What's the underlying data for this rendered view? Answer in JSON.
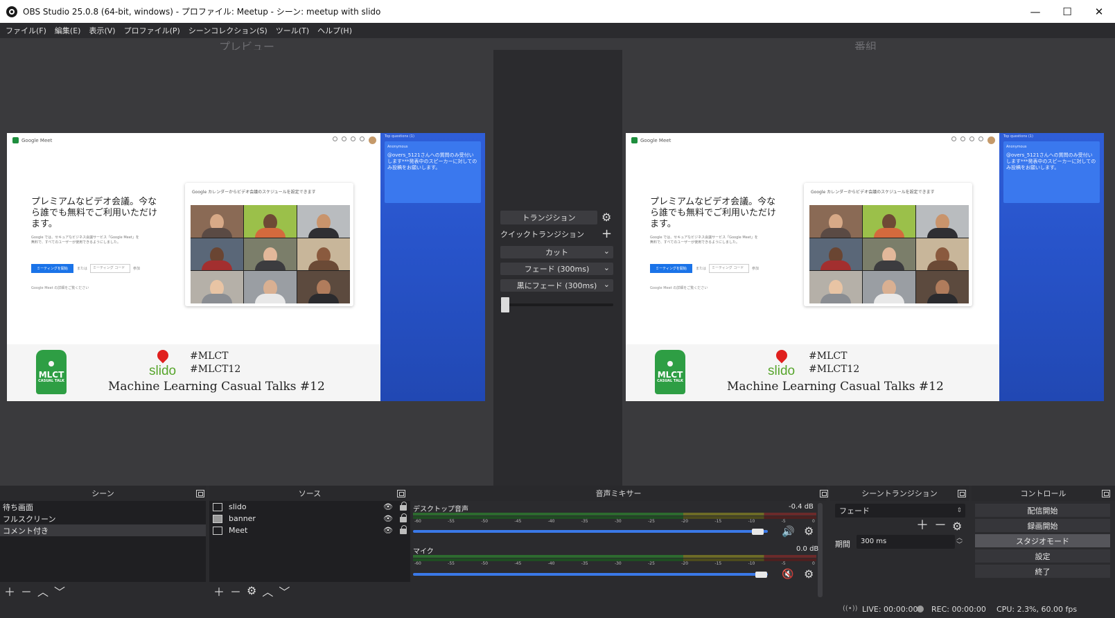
{
  "window": {
    "title": "OBS Studio 25.0.8 (64-bit, windows) - プロファイル: Meetup - シーン: meetup with slido",
    "minimize": "—",
    "maximize": "☐",
    "close": "✕"
  },
  "menu": [
    "ファイル(F)",
    "編集(E)",
    "表示(V)",
    "プロファイル(P)",
    "シーンコレクション(S)",
    "ツール(T)",
    "ヘルプ(H)"
  ],
  "preview": {
    "left_label": "プレビュー",
    "right_label": "番組"
  },
  "canvas": {
    "meet_brand": "Google Meet",
    "headline": "プレミアムなビデオ会議。今なら誰でも無料でご利用いただけます。",
    "subtext": "Google では、セキュアなビジネス会議サービス「Google Meet」を無料で、すべてのユーザーが使用できるようにしました。",
    "start_button": "ミーティングを開始",
    "or_text": "または",
    "code_placeholder": "ミーティング コード",
    "join_text": "参加",
    "learn_more": "Google Meet の詳細をご覧ください",
    "card_caption": "Google カレンダーからビデオ会議のスケジュールを設定できます",
    "tag_line1": "MLCT",
    "tag_line2": "CASUAL TALK",
    "slido": "slido",
    "hashtag1": "#MLCT",
    "hashtag2": "#MLCT12",
    "talk_title": "Machine Learning Casual Talks #12",
    "slido_header": "Top questions (1)",
    "slido_user": "Anonymous",
    "slido_question": "@overs_5121さんへの質問のみ受付いします***発表中のスピーカーに対してのみ投稿をお願いします。"
  },
  "transitions": {
    "transition_label": "トランジション",
    "quick_label": "クイックトランジション",
    "items": [
      "カット",
      "フェード (300ms)",
      "黒にフェード (300ms)"
    ]
  },
  "docks": {
    "scenes": {
      "title": "シーン",
      "items": [
        "待ち画面",
        "フルスクリーン",
        "コメント付き"
      ],
      "selected": "コメント付き"
    },
    "sources": {
      "title": "ソース",
      "items": [
        "slido",
        "banner",
        "Meet"
      ]
    },
    "mixer": {
      "title": "音声ミキサー",
      "channels": [
        {
          "name": "デスクトップ音声",
          "db": "-0.4 dB",
          "volume": 0.97,
          "muted": false
        },
        {
          "name": "マイク",
          "db": "0.0 dB",
          "volume": 0.98,
          "muted": true
        }
      ],
      "ticks": [
        "-60",
        "-55",
        "-50",
        "-45",
        "-40",
        "-35",
        "-30",
        "-25",
        "-20",
        "-15",
        "-10",
        "-5",
        "0"
      ]
    },
    "scene_transitions": {
      "title": "シーントランジション",
      "selected": "フェード",
      "duration_label": "期間",
      "duration_value": "300 ms"
    },
    "controls": {
      "title": "コントロール",
      "buttons": [
        "配信開始",
        "録画開始",
        "スタジオモード",
        "設定",
        "終了"
      ],
      "active": "スタジオモード"
    }
  },
  "status": {
    "live": "LIVE: 00:00:00",
    "rec": "REC: 00:00:00",
    "cpu": "CPU: 2.3%, 60.00 fps"
  },
  "colors": {
    "accent": "#3a79e8",
    "slido_blue": "#2f5ed8",
    "mlct_green": "#2e9e44",
    "mute_red": "#e0201e"
  }
}
